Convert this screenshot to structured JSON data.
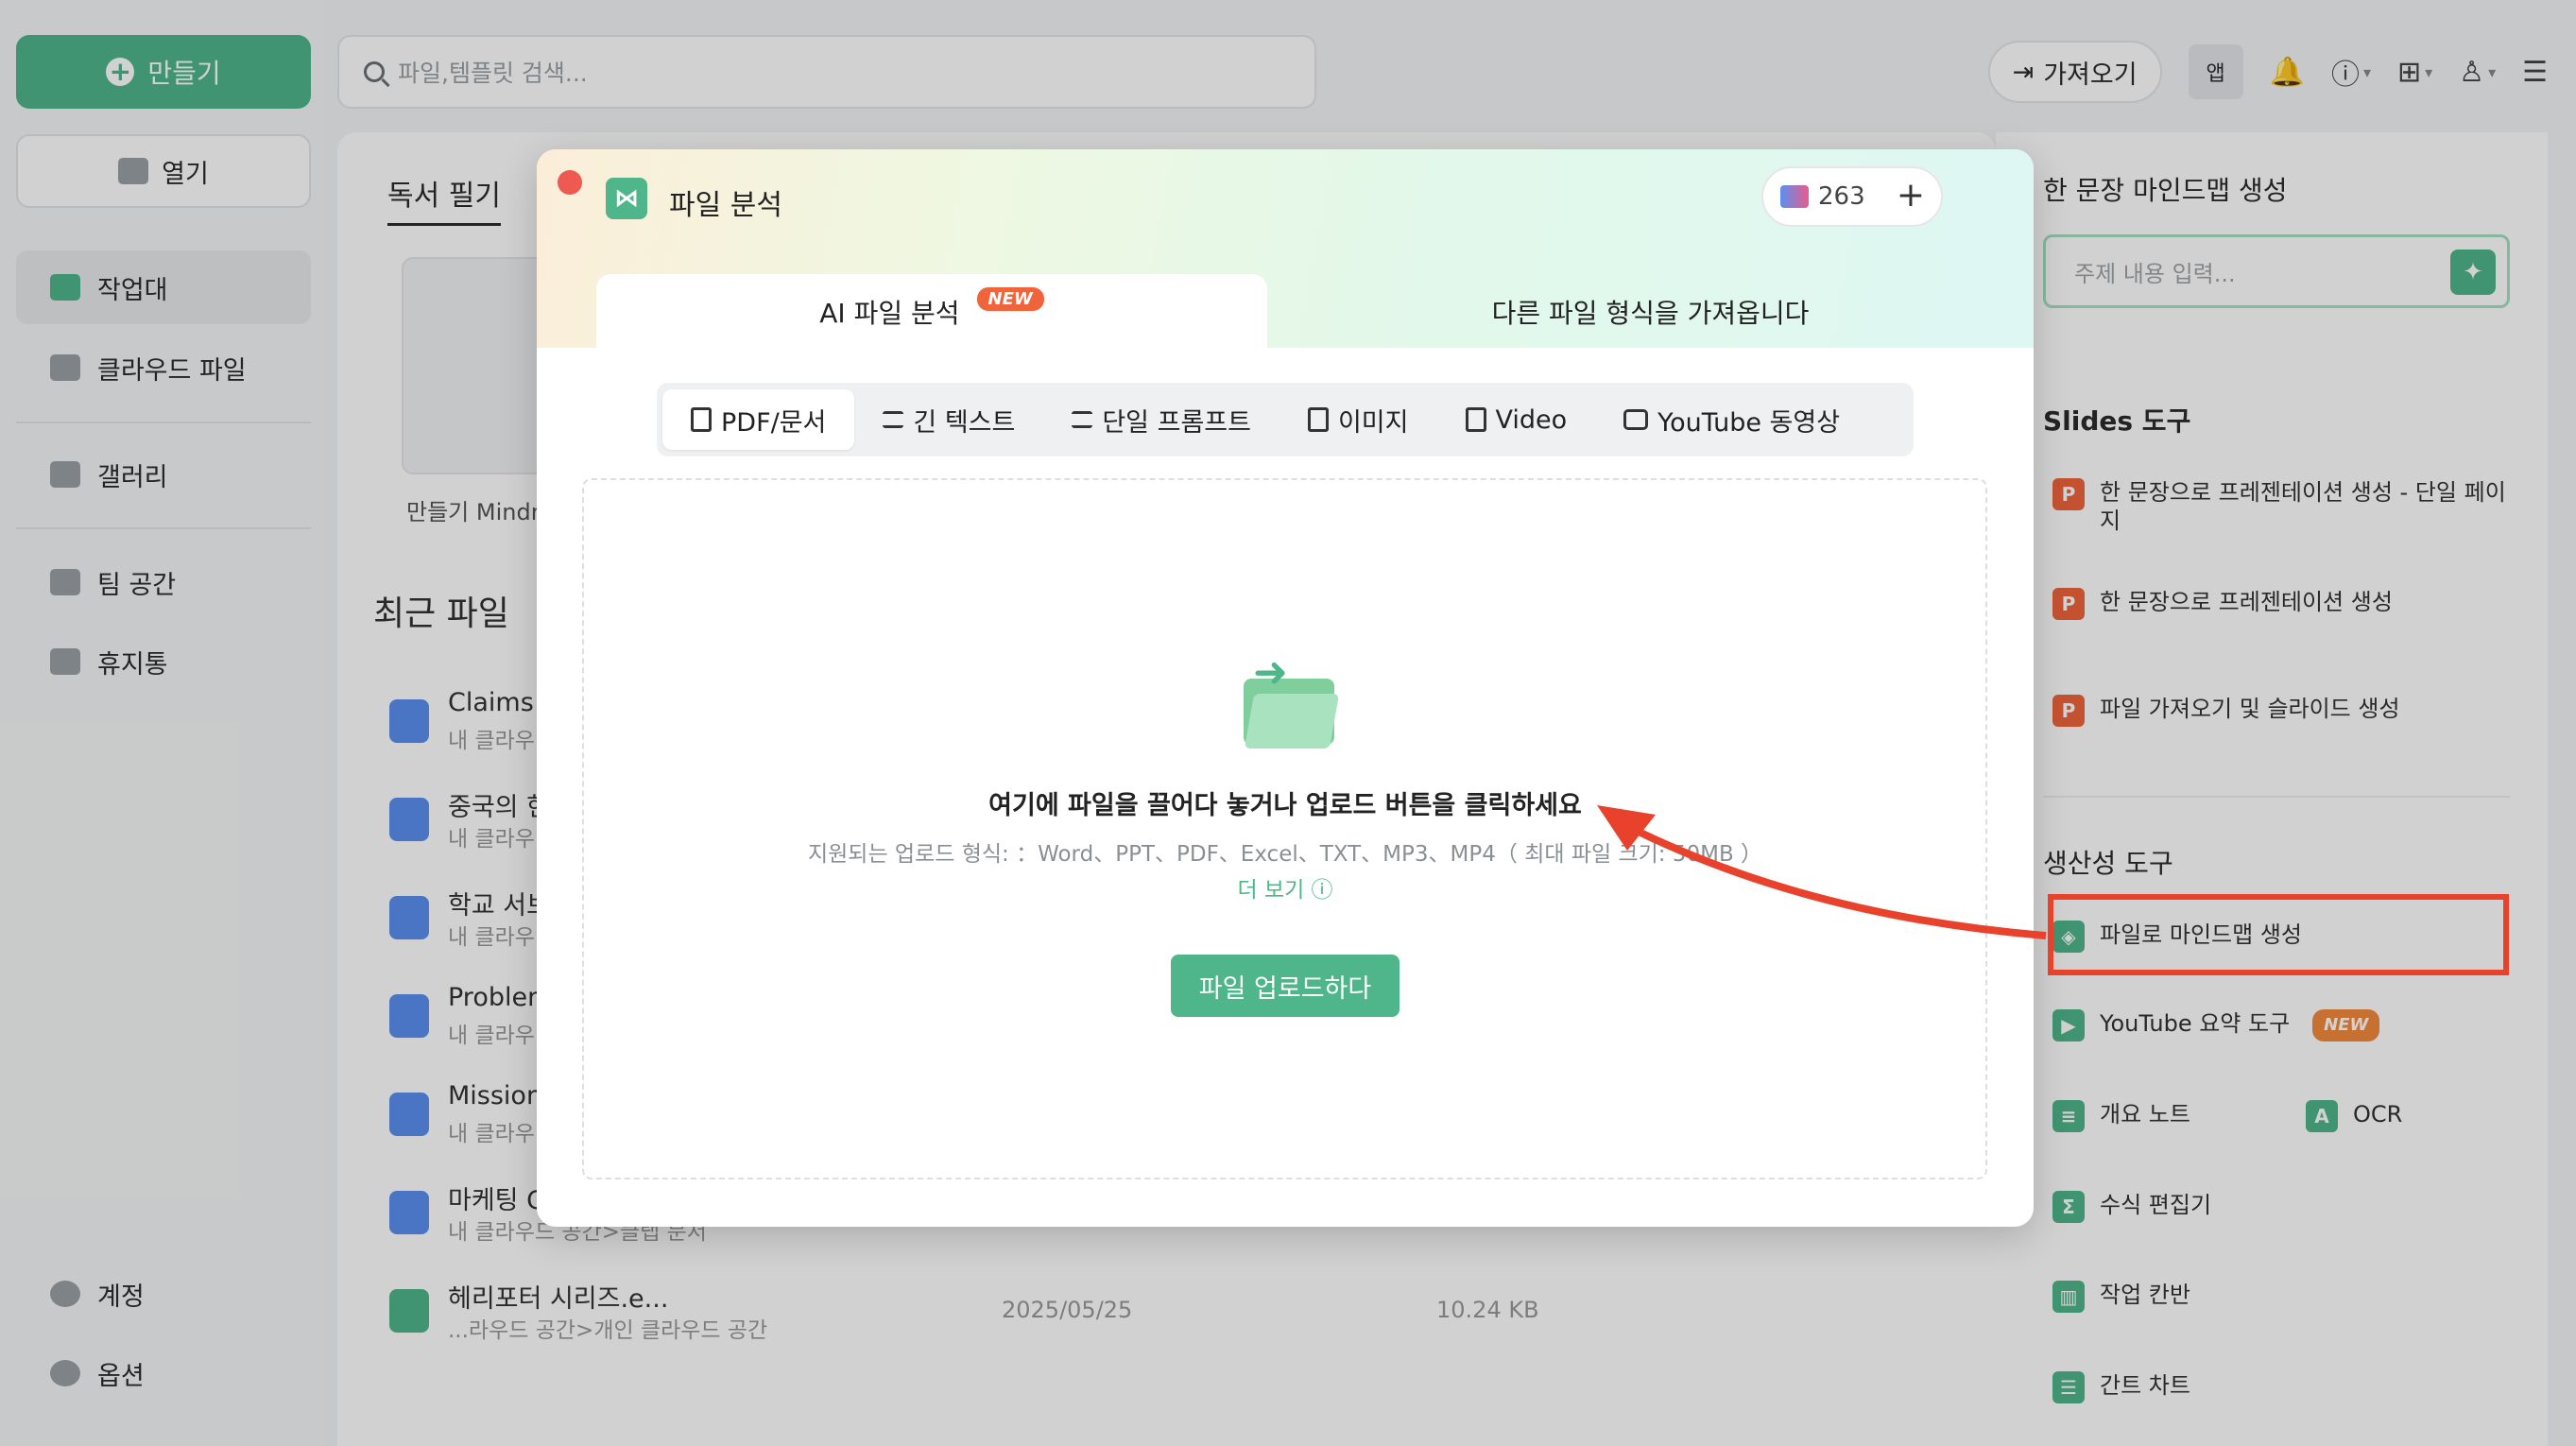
{
  "sidebar": {
    "create_label": "만들기",
    "open_label": "열기",
    "items": [
      {
        "label": "작업대"
      },
      {
        "label": "클라우드 파일"
      },
      {
        "label": "갤러리"
      },
      {
        "label": "팀 공간"
      },
      {
        "label": "휴지통"
      }
    ],
    "bottom": [
      {
        "label": "계정"
      },
      {
        "label": "옵션"
      }
    ]
  },
  "search": {
    "placeholder": "파일,템플릿 검색..."
  },
  "topbar": {
    "import_label": "가져오기",
    "app_label": "앱"
  },
  "main": {
    "tab_reading": "독서 필기",
    "thumb_label": "만들기 Mindm",
    "recent_title": "최근 파일",
    "files": [
      {
        "name": "Claims a",
        "path": "내 클라우"
      },
      {
        "name": "중국의 현",
        "path": "내 클라우"
      },
      {
        "name": "학교 서브",
        "path": "내 클라우"
      },
      {
        "name": "Problem",
        "path": "내 클라우"
      },
      {
        "name": "Mission",
        "path": "내 클라우"
      },
      {
        "name": "마케팅 C",
        "path": "내 클라우드 공간>클랩 문서"
      },
      {
        "name": "헤리포터 시리즈.e...",
        "path": "...라우드 공간>개인 클라우드 공간",
        "date": "2025/05/25",
        "size": "10.24 KB"
      }
    ]
  },
  "right_panel": {
    "one_sentence_title": "한 문장 마인드맵 생성",
    "topic_placeholder": "주제 내용 입력...",
    "slides_title": "Slides 도구",
    "slides_items": [
      {
        "label": "한 문장으로 프레젠테이션 생성 - 단일 페이지"
      },
      {
        "label": "한 문장으로 프레젠테이션 생성"
      },
      {
        "label": "파일 가져오기 및 슬라이드 생성"
      }
    ],
    "productivity_title": "생산성 도구",
    "productivity_items": [
      {
        "label": "파일로 마인드맵 생성"
      },
      {
        "label": "YouTube 요약 도구",
        "badge": "NEW"
      },
      {
        "label": "개요 노트"
      },
      {
        "label": "OCR"
      },
      {
        "label": "수식 편집기"
      },
      {
        "label": "작업 칸반"
      },
      {
        "label": "간트 차트"
      }
    ]
  },
  "modal": {
    "title": "파일 분석",
    "credits": "263",
    "tab_ai": "AI 파일 분석",
    "tab_ai_badge": "NEW",
    "tab_import": "다른 파일 형식을 가져옵니다",
    "sub_tabs": [
      {
        "label": "PDF/문서"
      },
      {
        "label": "긴 텍스트"
      },
      {
        "label": "단일 프롬프트"
      },
      {
        "label": "이미지"
      },
      {
        "label": "Video"
      },
      {
        "label": "YouTube 동영상"
      }
    ],
    "drop_title": "여기에 파일을 끌어다 놓거나 업로드 버튼을 클릭하세요",
    "formats": "지원되는 업로드 형식: ：Word、PPT、PDF、Excel、TXT、MP3、MP4（ 최대 파일 크기: 50MB ）",
    "more_label": "더 보기",
    "upload_label": "파일 업로드하다"
  },
  "colors": {
    "accent": "#4fb58a",
    "annotation": "#e8422c",
    "close_dot": "#ee5a52"
  }
}
